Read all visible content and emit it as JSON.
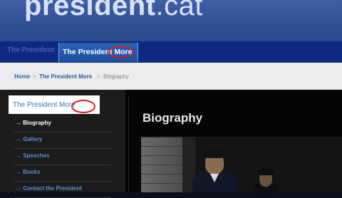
{
  "header": {
    "logo_name": "president",
    "logo_tld": ".cat"
  },
  "nav": {
    "items": [
      "The President",
      "The President More"
    ],
    "active_label": "The President More"
  },
  "breadcrumb": {
    "home": "Home",
    "sep": ">",
    "parent": "The President More",
    "current": "Biography"
  },
  "sidebar": {
    "heading": "The President More",
    "items": [
      {
        "label": "→ Biography",
        "active": true
      },
      {
        "label": "→ Gallery",
        "active": false
      },
      {
        "label": "→ Speeches",
        "active": false
      },
      {
        "label": "→ Books",
        "active": false
      },
      {
        "label": "→ Contact the President",
        "active": false
      }
    ]
  },
  "main": {
    "title": "Biography"
  },
  "colors": {
    "header": "#2f4f95",
    "navbar": "#0e2a80",
    "highlight_ring": "#d8201e",
    "link": "#2a5aa5"
  }
}
